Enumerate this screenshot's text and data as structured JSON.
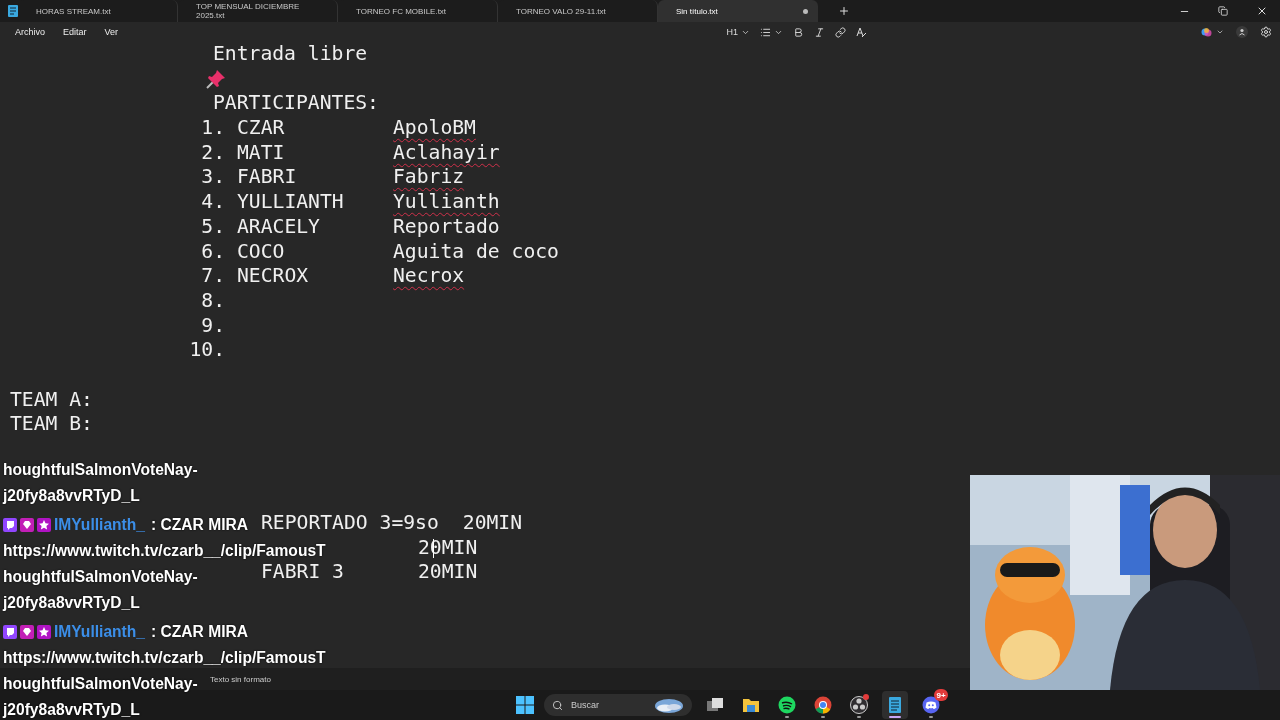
{
  "tabs": [
    {
      "label": "HORAS STREAM.txt",
      "selected": false,
      "unsaved": false
    },
    {
      "label": "TOP MENSUAL DICIEMBRE 2025.txt",
      "selected": false,
      "unsaved": false
    },
    {
      "label": "TORNEO FC MOBILE.txt",
      "selected": false,
      "unsaved": false
    },
    {
      "label": "TORNEO VALO 29-11.txt",
      "selected": false,
      "unsaved": false
    },
    {
      "label": "Sin título.txt",
      "selected": true,
      "unsaved": true
    }
  ],
  "menu": [
    "Archivo",
    "Editar",
    "Ver"
  ],
  "toolbar": {
    "heading": "H1"
  },
  "editor": {
    "lines": [
      {
        "kind": "heading",
        "text": "Entrada libre"
      },
      {
        "kind": "pin"
      },
      {
        "kind": "heading",
        "text": "PARTICIPANTES:"
      },
      {
        "kind": "item",
        "number": "1.",
        "name": "CZAR",
        "nick": "ApoloBM",
        "misspelled": true
      },
      {
        "kind": "item",
        "number": "2.",
        "name": "MATI",
        "nick": "Aclahayir",
        "misspelled": true
      },
      {
        "kind": "item",
        "number": "3.",
        "name": "FABRI",
        "nick": "Fabriz",
        "misspelled": true
      },
      {
        "kind": "item",
        "number": "4.",
        "name": "YULLIANTH",
        "nick": "Yullianth",
        "misspelled": true
      },
      {
        "kind": "item",
        "number": "5.",
        "name": "ARACELY",
        "nick": "Reportado",
        "misspelled": false
      },
      {
        "kind": "item",
        "number": "6.",
        "name": "COCO",
        "nick": "Aguita de coco",
        "misspelled": false
      },
      {
        "kind": "item",
        "number": "7.",
        "name": "NECROX",
        "nick": "Necrox",
        "misspelled": true
      },
      {
        "kind": "item",
        "number": "8."
      },
      {
        "kind": "item",
        "number": "9."
      },
      {
        "kind": "item",
        "number": "10."
      },
      {
        "kind": "blank"
      },
      {
        "kind": "plain",
        "text": "TEAM A:"
      },
      {
        "kind": "plain",
        "text": "TEAM B:"
      },
      {
        "kind": "blank"
      },
      {
        "kind": "blank"
      },
      {
        "kind": "blank"
      },
      {
        "kind": "score",
        "name": "REPORTADO 3=9so",
        "time": "20MIN",
        "caret": false
      },
      {
        "kind": "score",
        "time": "20MIN",
        "caret": true
      },
      {
        "kind": "score",
        "name": "FABRI 3",
        "time": "20MIN",
        "caret": false
      }
    ]
  },
  "chat": [
    {
      "kind": "continuation",
      "lines": [
        "houghtfulSalmonVoteNay-",
        "j20fy8a8vvRTyD_L"
      ]
    },
    {
      "kind": "message",
      "user": "IMYullianth_",
      "text": ": CZAR MIRA",
      "lines": [
        "https://www.twitch.tv/czarb__/clip/FamousT",
        "houghtfulSalmonVoteNay-",
        "j20fy8a8vvRTyD_L"
      ]
    },
    {
      "kind": "message",
      "user": "IMYullianth_",
      "text": ": CZAR MIRA",
      "lines": [
        "https://www.twitch.tv/czarb__/clip/FamousT",
        "houghtfulSalmonVoteNay-",
        "j20fy8a8vvRTyD_L"
      ]
    }
  ],
  "status_bar": {
    "format": "Texto sin formato"
  },
  "taskbar": {
    "search_placeholder": "Buscar",
    "apps": [
      {
        "kind": "taskview",
        "running": false,
        "active": false
      },
      {
        "kind": "files",
        "running": false,
        "active": false
      },
      {
        "kind": "spotify",
        "running": true,
        "active": false
      },
      {
        "kind": "chrome",
        "running": true,
        "active": false
      },
      {
        "kind": "obs",
        "running": true,
        "active": false,
        "alert": true
      },
      {
        "kind": "notepad",
        "running": true,
        "active": true
      },
      {
        "kind": "discord",
        "running": true,
        "active": false,
        "badge": "9+"
      }
    ]
  }
}
